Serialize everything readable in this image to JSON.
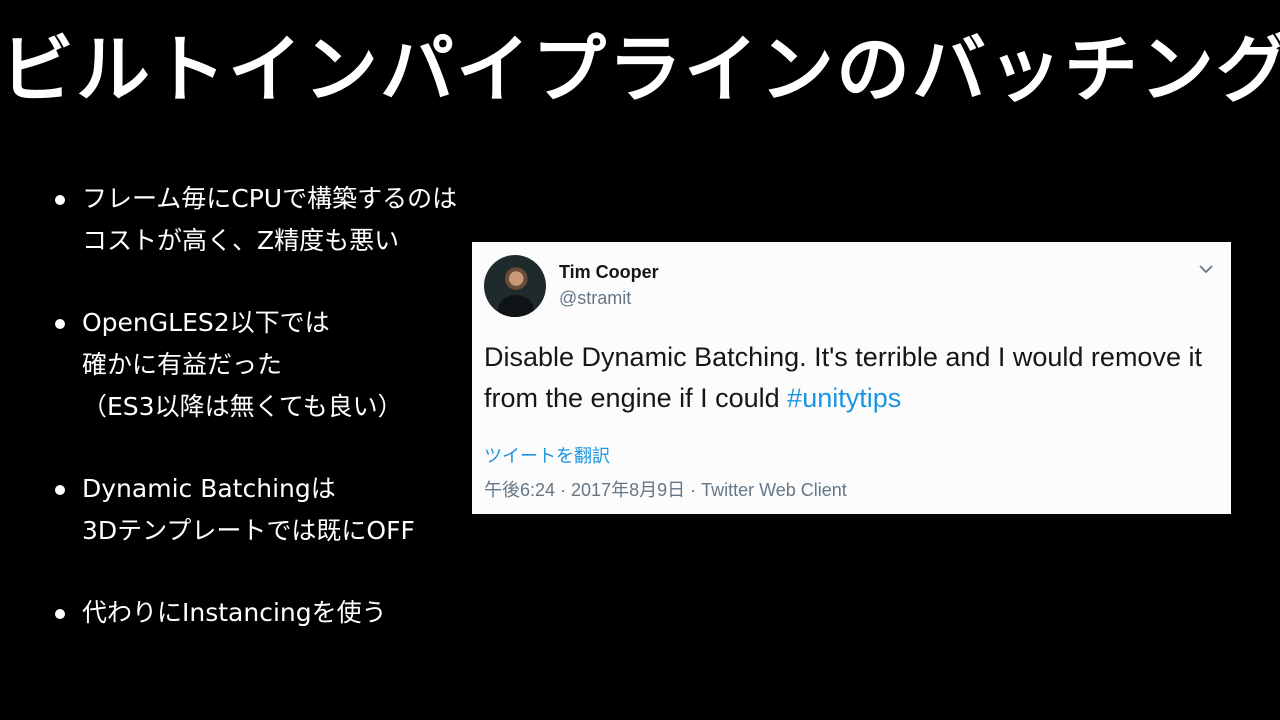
{
  "slide": {
    "title": "ビルトインパイプラインのバッチング"
  },
  "bullets": [
    {
      "lines": [
        "フレーム毎にCPUで構築するのは",
        "コストが高く、Z精度も悪い"
      ]
    },
    {
      "lines": [
        "OpenGLES2以下では",
        "確かに有益だった",
        "（ES3以降は無くても良い）"
      ]
    },
    {
      "lines": [
        "Dynamic Batchingは",
        "3Dテンプレートでは既にOFF"
      ]
    },
    {
      "lines": [
        "代わりにInstancingを使う"
      ]
    }
  ],
  "tweet": {
    "author_name": "Tim Cooper",
    "author_handle": "@stramit",
    "text": "Disable Dynamic Batching. It's terrible and I would remove it from the engine if I could ",
    "hashtag": "#unitytips",
    "translate_label": "ツイートを翻訳",
    "meta": "午後6:24 · 2017年8月9日 · Twitter Web Client",
    "avatar_icon": "user-avatar",
    "menu_icon": "chevron-down-icon",
    "link_color": "#1b95e0"
  }
}
